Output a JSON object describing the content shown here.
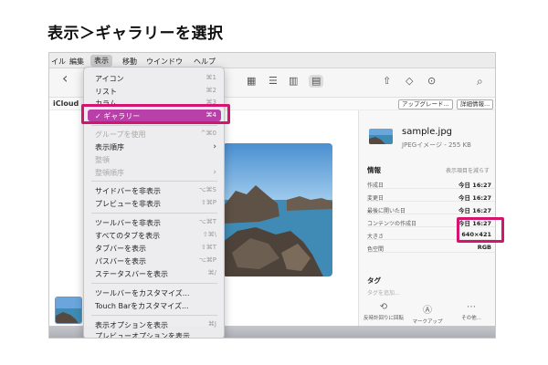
{
  "page": {
    "title": "表示＞ギャラリーを選択"
  },
  "menubar": {
    "items": [
      "イル",
      "編集",
      "表示",
      "移動",
      "ウインドウ",
      "ヘルプ"
    ]
  },
  "toolbar": {
    "back_icon": "‹",
    "view_icons": [
      "grid-icon",
      "list-icon",
      "columns-icon",
      "gallery-icon"
    ],
    "view_glyphs": [
      "▦",
      "☰",
      "▥",
      "▤"
    ],
    "share_glyph": "⇧",
    "tag_glyph": "◇",
    "more_glyph": "⊙",
    "search_glyph": "⌕"
  },
  "pathbar": {
    "location": "iCloud",
    "upgrade_button": "アップグレード...",
    "details_button": "詳細情報..."
  },
  "menu": {
    "items": [
      {
        "label": "アイコン",
        "shortcut": "⌘1",
        "state": "normal"
      },
      {
        "label": "リスト",
        "shortcut": "⌘2",
        "state": "normal"
      },
      {
        "label": "カラム",
        "shortcut": "⌘3",
        "state": "normal"
      },
      {
        "label": "✓ ギャラリー",
        "shortcut": "⌘4",
        "state": "highlighted"
      },
      {
        "label": "グループを使用",
        "shortcut": "^⌘0",
        "state": "disabled"
      },
      {
        "label": "表示順序",
        "shortcut": "›",
        "state": "normal"
      },
      {
        "label": "整頓",
        "shortcut": "",
        "state": "disabled"
      },
      {
        "label": "整頓順序",
        "shortcut": "›",
        "state": "disabled"
      },
      {
        "label": "サイドバーを非表示",
        "shortcut": "⌥⌘S",
        "state": "normal"
      },
      {
        "label": "プレビューを非表示",
        "shortcut": "⇧⌘P",
        "state": "normal"
      },
      {
        "label": "ツールバーを非表示",
        "shortcut": "⌥⌘T",
        "state": "normal"
      },
      {
        "label": "すべてのタブを表示",
        "shortcut": "⇧⌘\\",
        "state": "normal"
      },
      {
        "label": "タブバーを表示",
        "shortcut": "⇧⌘T",
        "state": "normal"
      },
      {
        "label": "パスバーを表示",
        "shortcut": "⌥⌘P",
        "state": "normal"
      },
      {
        "label": "ステータスバーを表示",
        "shortcut": "⌘/",
        "state": "normal"
      },
      {
        "label": "ツールバーをカスタマイズ...",
        "shortcut": "",
        "state": "normal"
      },
      {
        "label": "Touch Barをカスタマイズ...",
        "shortcut": "",
        "state": "normal"
      },
      {
        "label": "表示オプションを表示",
        "shortcut": "⌘J",
        "state": "normal"
      },
      {
        "label": "プレビューオプションを表示",
        "shortcut": "",
        "state": "normal"
      }
    ]
  },
  "inspector": {
    "filename": "sample.jpg",
    "subtitle": "JPEGイメージ - 255 KB",
    "info_title": "情報",
    "info_more": "表示項目を減らす",
    "rows": [
      {
        "key": "作成日",
        "value": "今日 16:27"
      },
      {
        "key": "変更日",
        "value": "今日 16:27"
      },
      {
        "key": "最後に開いた日",
        "value": "今日 16:27"
      },
      {
        "key": "コンテンツの作成日",
        "value": "今日 16:27"
      },
      {
        "key": "大きさ",
        "value": "640×421"
      },
      {
        "key": "色空間",
        "value": "RGB"
      }
    ],
    "tags_title": "タグ",
    "tags_placeholder": "タグを追加...",
    "actions": [
      {
        "icon": "rotate-left-icon",
        "glyph": "⟲",
        "label": "反時計回りに回転"
      },
      {
        "icon": "markup-icon",
        "glyph": "Ⓐ",
        "label": "マークアップ"
      },
      {
        "icon": "more-icon",
        "glyph": "⋯",
        "label": "その他..."
      }
    ]
  },
  "colors": {
    "menu_highlight": "#b93fa9",
    "annotation_box": "#d4146f"
  }
}
